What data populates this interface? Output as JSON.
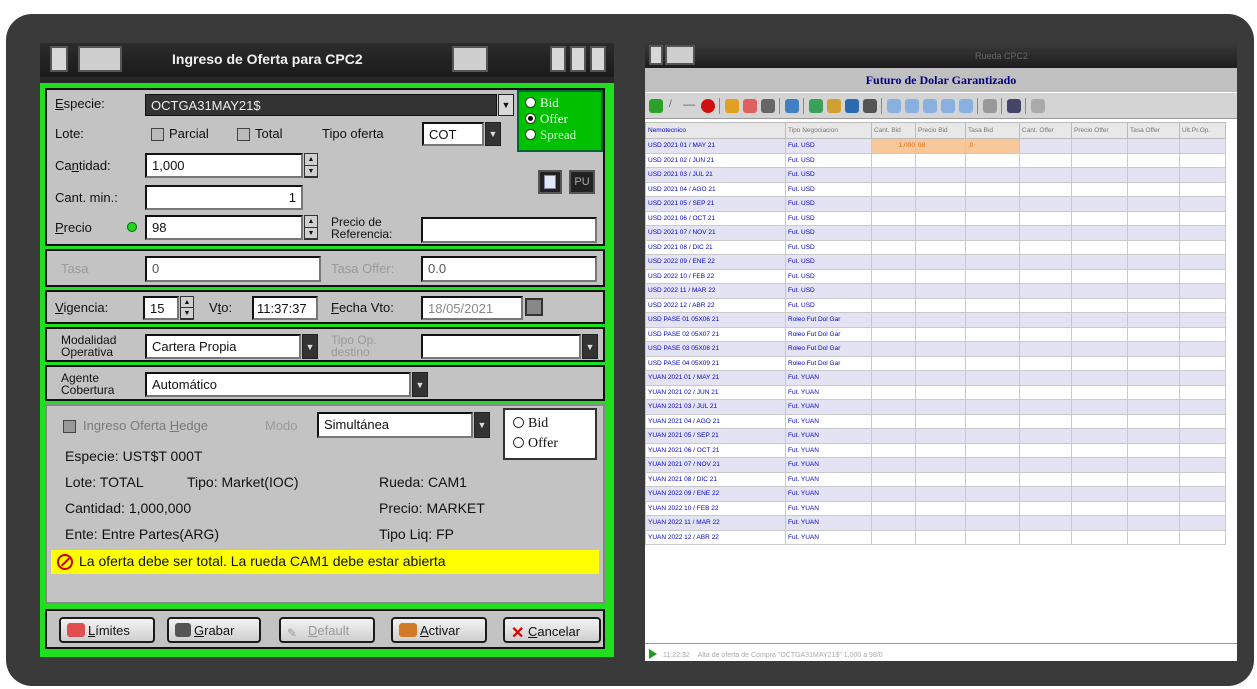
{
  "dialog": {
    "title": "Ingreso de Oferta para CPC2",
    "especie_label": "Especie:",
    "especie_value": "OCTGA31MAY21$",
    "side_options": [
      "Bid",
      "Offer",
      "Spread"
    ],
    "side_selected": "Offer",
    "lote_label": "Lote:",
    "lote_parcial": "Parcial",
    "lote_total": "Total",
    "tipo_oferta_label": "Tipo oferta",
    "tipo_oferta_value": "COT",
    "cantidad_label": "Cantidad:",
    "cantidad_value": "1,000",
    "cant_min_label": "Cant. min.:",
    "cant_min_value": "1",
    "calc_button": "calculator-icon",
    "pu_button": "PU",
    "precio_label": "Precio",
    "precio_value": "98",
    "precio_ref_label_1": "Precio de",
    "precio_ref_label_2": "Referencia:",
    "precio_ref_value": "",
    "tasa_label": "Tasa",
    "tasa_value": "0",
    "tasa_offer_label": "Tasa Offer:",
    "tasa_offer_value": "0.0",
    "vigencia_label": "Vigencia:",
    "vigencia_value": "15",
    "vto_label": "Vto:",
    "vto_value": "11:37:37",
    "fecha_vto_label": "Fecha Vto:",
    "fecha_vto_value": "18/05/2021",
    "modalidad_label_1": "Modalidad",
    "modalidad_label_2": "Operativa",
    "modalidad_value": "Cartera Propia",
    "tipo_op_label_1": "Tipo Op.",
    "tipo_op_label_2": "destino",
    "tipo_op_value": "",
    "agente_label_1": "Agente",
    "agente_label_2": "Cobertura",
    "agente_value": "Automático",
    "hedge": {
      "checkbox_label": "Ingreso Oferta Hedge",
      "modo_label": "Modo",
      "modo_value": "Simultánea",
      "side_options": [
        "Bid",
        "Offer"
      ],
      "especie": "Especie: UST$T  000T",
      "lote": "Lote: TOTAL",
      "tipo": "Tipo: Market(IOC)",
      "rueda": "Rueda: CAM1",
      "cantidad": "Cantidad: 1,000,000",
      "precio": "Precio: MARKET",
      "ente": "Ente: Entre Partes(ARG)",
      "tipo_liq": "Tipo Liq: FP"
    },
    "alert": "La oferta debe ser total. La rueda CAM1 debe estar abierta",
    "buttons": {
      "limites": "Límites",
      "grabar": "Grabar",
      "default": "Default",
      "activar": "Activar",
      "cancelar": "Cancelar"
    }
  },
  "window": {
    "title": "Rueda CPC2",
    "subtitle": "Futuro de Dolar Garantizado",
    "columns": [
      "Nemotecnico",
      "Tipo Negociacion",
      "Cant. Bid",
      "Precio Bid",
      "Tasa Bid",
      "Cant. Offer",
      "Precio Offer",
      "Tasa Offer",
      "Ult.Pr.Op."
    ],
    "rows": [
      {
        "nemo": "USD 2021 01 / MAY 21",
        "tipo": "Fut. USD",
        "cant_bid": "1,000",
        "precio_bid": "98",
        "tasa_bid": ",0"
      },
      {
        "nemo": "USD 2021 02 / JUN 21",
        "tipo": "Fut. USD"
      },
      {
        "nemo": "USD 2021 03 / JUL 21",
        "tipo": "Fut. USD"
      },
      {
        "nemo": "USD 2021 04 / AGO 21",
        "tipo": "Fut. USD"
      },
      {
        "nemo": "USD 2021 05 / SEP 21",
        "tipo": "Fut. USD"
      },
      {
        "nemo": "USD 2021 06 / OCT 21",
        "tipo": "Fut. USD"
      },
      {
        "nemo": "USD 2021 07 / NOV 21",
        "tipo": "Fut. USD"
      },
      {
        "nemo": "USD 2021 08 / DIC 21",
        "tipo": "Fut. USD"
      },
      {
        "nemo": "USD 2022 09 / ENE 22",
        "tipo": "Fut. USD"
      },
      {
        "nemo": "USD 2022 10 / FEB 22",
        "tipo": "Fut. USD"
      },
      {
        "nemo": "USD 2022 11 / MAR 22",
        "tipo": "Fut. USD"
      },
      {
        "nemo": "USD 2022 12 / ABR 22",
        "tipo": "Fut. USD"
      },
      {
        "nemo": "USD PASE 01 05X06 21",
        "tipo": "Roleo Fut Dol Gar"
      },
      {
        "nemo": "USD PASE 02 05X07 21",
        "tipo": "Roleo Fut Dol Gar"
      },
      {
        "nemo": "USD PASE 03 05X08 21",
        "tipo": "Roleo Fut Dol Gar"
      },
      {
        "nemo": "USD PASE 04 05X09 21",
        "tipo": "Roleo Fut Dol Gar"
      },
      {
        "nemo": "YUAN 2021 01 / MAY 21",
        "tipo": "Fut. YUAN"
      },
      {
        "nemo": "YUAN 2021 02 / JUN 21",
        "tipo": "Fut. YUAN"
      },
      {
        "nemo": "YUAN 2021 03 / JUL 21",
        "tipo": "Fut. YUAN"
      },
      {
        "nemo": "YUAN 2021 04 / AGO 21",
        "tipo": "Fut. YUAN"
      },
      {
        "nemo": "YUAN 2021 05 / SEP 21",
        "tipo": "Fut. YUAN"
      },
      {
        "nemo": "YUAN 2021 06 / OCT 21",
        "tipo": "Fut. YUAN"
      },
      {
        "nemo": "YUAN 2021 07 / NOV 21",
        "tipo": "Fut. YUAN"
      },
      {
        "nemo": "YUAN 2021 08 / DIC 21",
        "tipo": "Fut. YUAN"
      },
      {
        "nemo": "YUAN 2022 09 / ENE 22",
        "tipo": "Fut. YUAN"
      },
      {
        "nemo": "YUAN 2022 10 / FEB 22",
        "tipo": "Fut. YUAN"
      },
      {
        "nemo": "YUAN 2022 11 / MAR 22",
        "tipo": "Fut. YUAN"
      },
      {
        "nemo": "YUAN 2022 12 / ABR 22",
        "tipo": "Fut. YUAN"
      }
    ],
    "status_time": "11:22:32",
    "status_text": "Alta de oferta de Compra \"OCTGA31MAY21$\" 1,000 a 98/0"
  },
  "colors": {
    "dialog_border": "#1ee01e",
    "dialog_panel": "#c3c3c3",
    "alert_bg": "#ffff00",
    "grid_text": "#0000cc",
    "grid_highlight": "#f9c79c",
    "subtitle": "#000080"
  }
}
